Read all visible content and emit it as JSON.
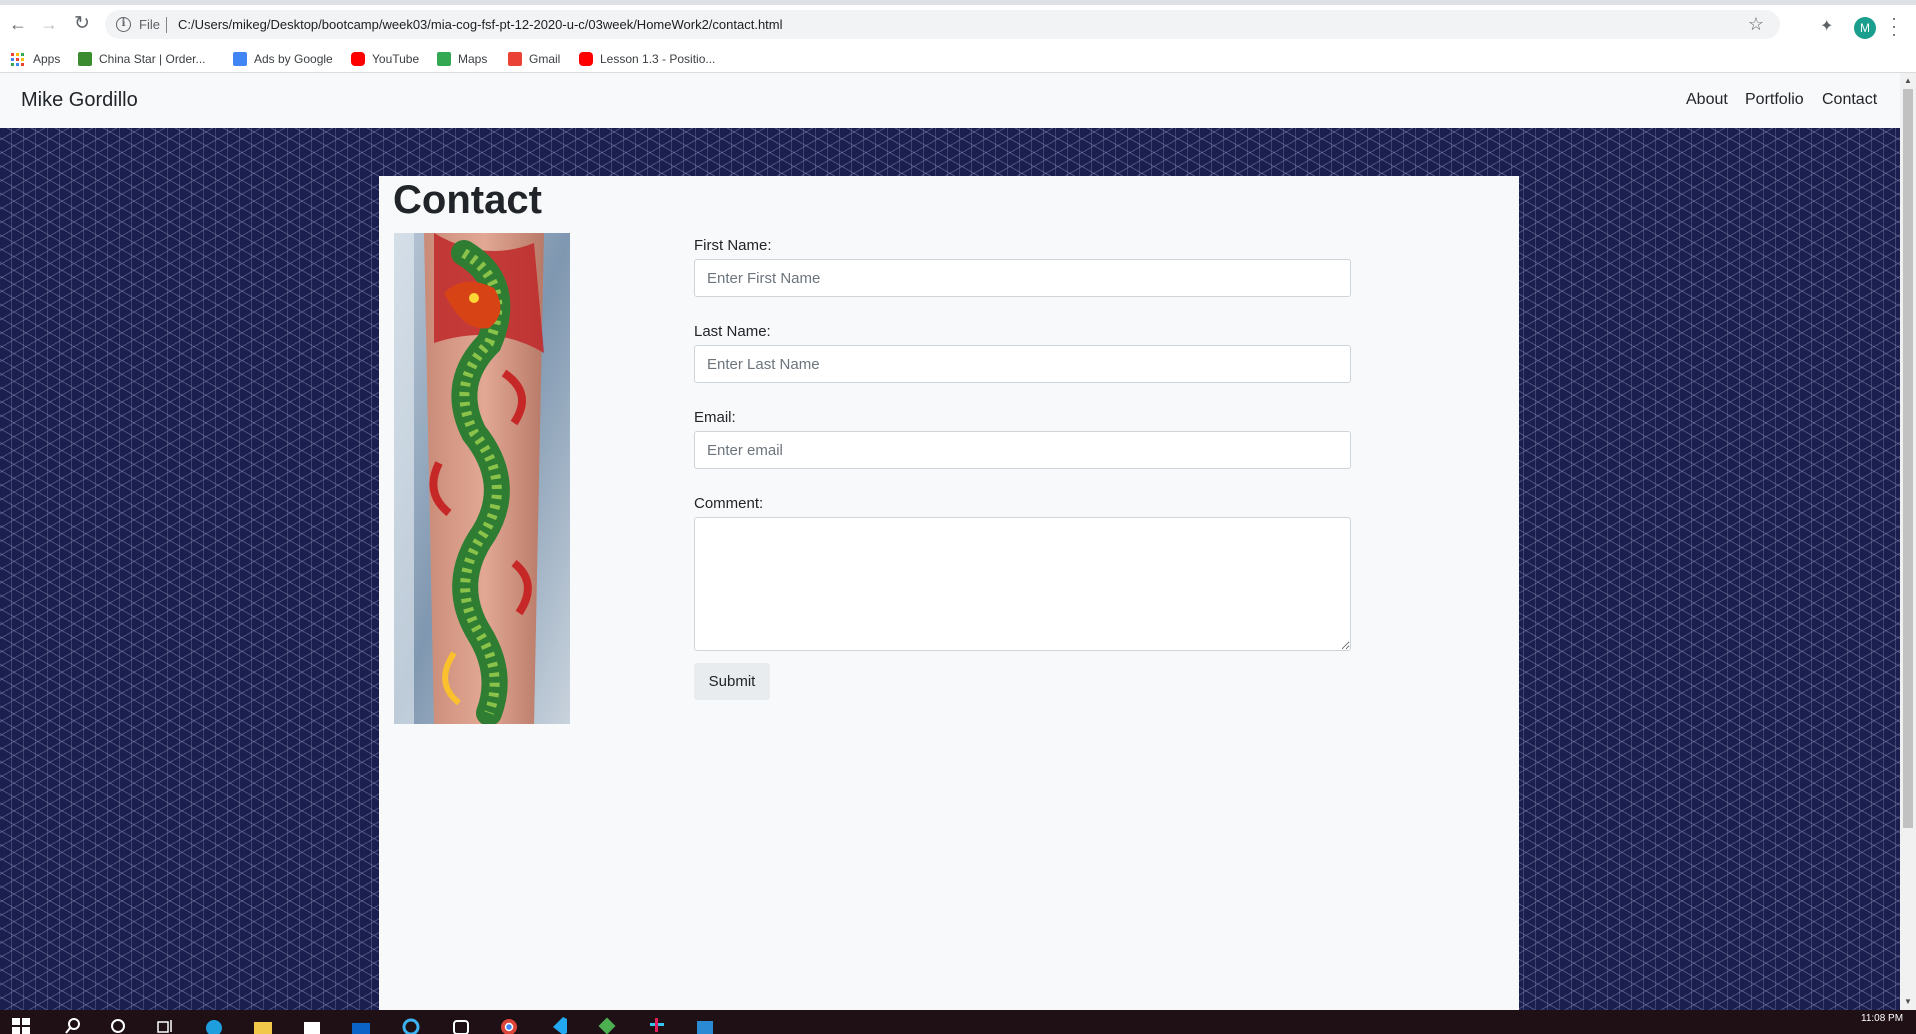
{
  "browser": {
    "file_label": "File",
    "url": "C:/Users/mikeg/Desktop/bootcamp/week03/mia-cog-fsf-pt-12-2020-u-c/03week/HomeWork2/contact.html",
    "profile_initial": "M",
    "bookmarks": [
      {
        "label": "Apps",
        "icon": "apps-grid-icon"
      },
      {
        "label": "China Star | Order...",
        "icon": "china-star-icon",
        "color": "#3a8c2f"
      },
      {
        "label": "Ads by Google",
        "icon": "google-ads-icon",
        "color": "#4285f4"
      },
      {
        "label": "YouTube",
        "icon": "youtube-icon",
        "color": "#ff0000"
      },
      {
        "label": "Maps",
        "icon": "maps-icon",
        "color": "#34a853"
      },
      {
        "label": "Gmail",
        "icon": "gmail-icon",
        "color": "#ea4335"
      },
      {
        "label": "Lesson 1.3 - Positio...",
        "icon": "youtube-icon",
        "color": "#ff0000"
      }
    ]
  },
  "site": {
    "brand": "Mike Gordillo",
    "nav": [
      "About",
      "Portfolio",
      "Contact"
    ]
  },
  "page": {
    "title": "Contact",
    "image": "dragon-tattoo-image",
    "form": {
      "first_name_label": "First Name:",
      "first_name_placeholder": "Enter First Name",
      "last_name_label": "Last Name:",
      "last_name_placeholder": "Enter Last Name",
      "email_label": "Email:",
      "email_placeholder": "Enter email",
      "comment_label": "Comment:",
      "submit_label": "Submit"
    }
  },
  "taskbar": {
    "clock": "11:08 PM"
  },
  "colors": {
    "background": "#1b1f4f",
    "card": "#f8f9fa",
    "navbar": "#f8f9fa"
  }
}
